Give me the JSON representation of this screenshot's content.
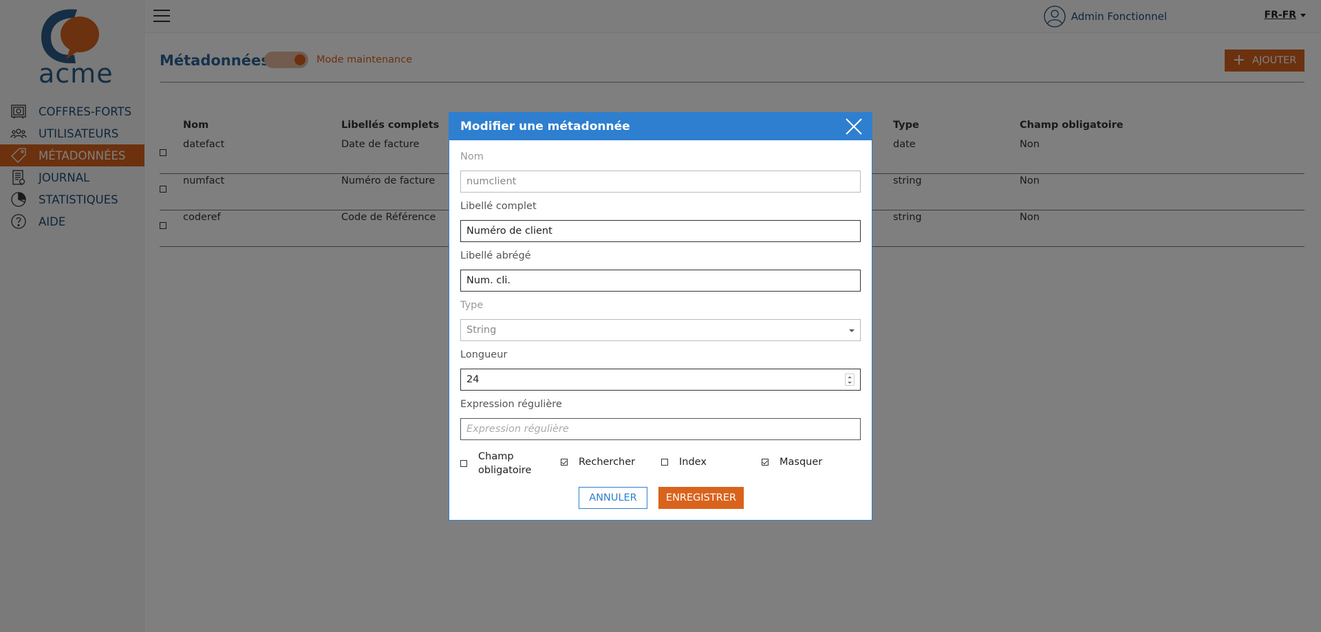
{
  "app": {
    "logo_text": "acme",
    "colors": {
      "accent": "#d9631c",
      "primary": "#2e7fcf",
      "title": "#2a6496"
    }
  },
  "sidebar": {
    "items": [
      {
        "label": "COFFRES-FORTS",
        "icon": "safe-icon",
        "active": false
      },
      {
        "label": "UTILISATEURS",
        "icon": "users-icon",
        "active": false
      },
      {
        "label": "MÉTADONNÉES",
        "icon": "tag-icon",
        "active": true
      },
      {
        "label": "JOURNAL",
        "icon": "journal-icon",
        "active": false
      },
      {
        "label": "STATISTIQUES",
        "icon": "pie-chart-icon",
        "active": false
      },
      {
        "label": "AIDE",
        "icon": "help-icon",
        "active": false
      }
    ]
  },
  "topbar": {
    "user_name": "Admin Fonctionnel",
    "language": "FR-FR"
  },
  "page": {
    "title": "Métadonnées",
    "maintenance_label": "Mode maintenance",
    "maintenance_on": true,
    "add_label": "AJOUTER"
  },
  "table": {
    "headers": {
      "name": "Nom",
      "full_label": "Libellés complets",
      "type": "Type",
      "required": "Champ obligatoire"
    },
    "rows": [
      {
        "name": "datefact",
        "full_label": "Date de facture",
        "type": "date",
        "required": "Non"
      },
      {
        "name": "numfact",
        "full_label": "Numéro de facture",
        "type": "string",
        "required": "Non"
      },
      {
        "name": "coderef",
        "full_label": "Code de Référence",
        "type": "string",
        "required": "Non"
      }
    ]
  },
  "modal": {
    "title": "Modifier une métadonnée",
    "name_label": "Nom",
    "name_value": "numclient",
    "full_label_label": "Libellé complet",
    "full_label_value": "Numéro de client",
    "short_label_label": "Libellé abrégé",
    "short_label_value": "Num. cli.",
    "type_label": "Type",
    "type_value": "String",
    "length_label": "Longueur",
    "length_value": "24",
    "regex_label": "Expression régulière",
    "regex_placeholder": "Expression régulière",
    "checks": {
      "required_line1": "Champ",
      "required_line2": "obligatoire",
      "required_checked": false,
      "search": "Rechercher",
      "search_checked": true,
      "index": "Index",
      "index_checked": false,
      "hide": "Masquer",
      "hide_checked": true
    },
    "cancel_label": "ANNULER",
    "save_label": "ENREGISTRER"
  }
}
